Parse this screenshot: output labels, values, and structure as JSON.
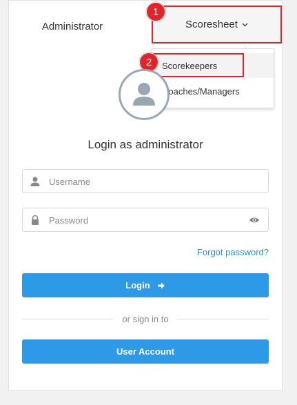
{
  "tabs": {
    "administrator": "Administrator",
    "scoresheet": "Scoresheet"
  },
  "dropdown": {
    "items": [
      "Scorekeepers",
      "Coaches/Managers"
    ]
  },
  "badges": [
    "1",
    "2"
  ],
  "login": {
    "title": "Login as administrator",
    "username_placeholder": "Username",
    "password_placeholder": "Password",
    "forgot_link": "Forgot password?",
    "login_button": "Login",
    "divider_text": "or sign in to",
    "user_account_button": "User Account"
  },
  "colors": {
    "accent": "#2d9ae8",
    "highlight": "#e3242b",
    "link": "#2b8fd6"
  },
  "icons": {
    "avatar": "user-avatar-icon",
    "username": "user-icon",
    "password": "lock-icon",
    "show_password": "eye-icon",
    "login": "arrow-right-icon",
    "dropdown": "chevron-down-icon"
  }
}
